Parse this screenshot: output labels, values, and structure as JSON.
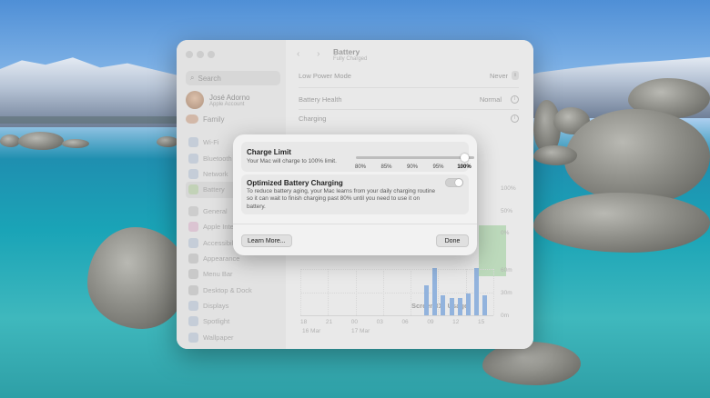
{
  "window": {
    "title": "Battery",
    "subtitle": "Fully Charged",
    "nav_arrows": "‹ ›",
    "search_placeholder": "Search",
    "account": {
      "name": "José Adorno",
      "subtitle": "Apple Account"
    },
    "family_label": "Family",
    "sidebar_items": [
      {
        "label": "Wi-Fi",
        "icon": "wifi-icon",
        "active": false
      },
      {
        "label": "Bluetooth",
        "icon": "bluetooth-icon",
        "active": false
      },
      {
        "label": "Network",
        "icon": "network-icon",
        "active": false
      },
      {
        "label": "Battery",
        "icon": "battery-icon",
        "active": true
      },
      {
        "label": "General",
        "icon": "gear-icon",
        "active": false
      },
      {
        "label": "Apple Intell…",
        "icon": "apple-intelligence-icon",
        "active": false
      },
      {
        "label": "Accessibility",
        "icon": "accessibility-icon",
        "active": false
      },
      {
        "label": "Appearance",
        "icon": "appearance-icon",
        "active": false
      },
      {
        "label": "Menu Bar",
        "icon": "menu-bar-icon",
        "active": false
      },
      {
        "label": "Desktop & Dock",
        "icon": "desktop-dock-icon",
        "active": false
      },
      {
        "label": "Displays",
        "icon": "display-icon",
        "active": false
      },
      {
        "label": "Spotlight",
        "icon": "spotlight-icon",
        "active": false
      },
      {
        "label": "Wallpaper",
        "icon": "wallpaper-icon",
        "active": false
      }
    ],
    "rows": {
      "low_power_label": "Low Power Mode",
      "low_power_value": "Never",
      "health_label": "Battery Health",
      "health_value": "Normal",
      "charging_label": "Charging"
    },
    "battery_axis": [
      "100%",
      "50%",
      "0%"
    ],
    "usage": {
      "title": "Screen On Usage",
      "y_labels": [
        "60m",
        "30m",
        "0m"
      ],
      "x_labels": [
        "18",
        "21",
        "00",
        "03",
        "06",
        "09",
        "12",
        "15"
      ],
      "dates": [
        "16 Mar",
        "17 Mar"
      ],
      "bar_values": [
        38,
        60,
        25,
        22,
        22,
        28,
        60,
        25
      ]
    }
  },
  "sheet": {
    "charge_limit": {
      "title": "Charge Limit",
      "description": "Your Mac will charge to 100% limit.",
      "options": [
        "80%",
        "85%",
        "90%",
        "95%",
        "100%"
      ],
      "selected_index": 4
    },
    "optimized": {
      "title": "Optimized Battery Charging",
      "description": "To reduce battery aging, your Mac learns from your daily charging routine so it can wait to finish charging past 80% until you need to use it on battery.",
      "enabled": false
    },
    "learn_more_label": "Learn More...",
    "done_label": "Done"
  }
}
